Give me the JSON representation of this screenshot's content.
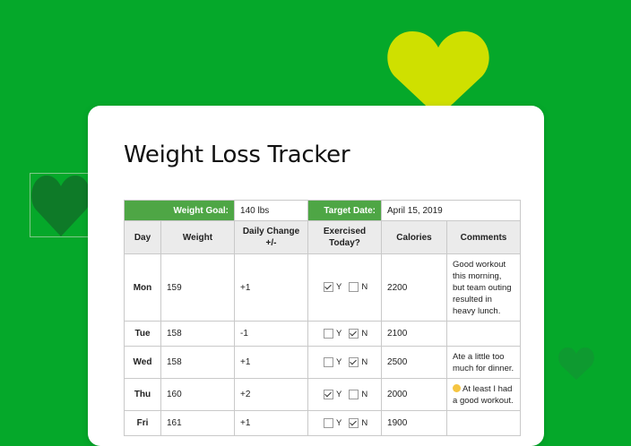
{
  "title": "Weight Loss Tracker",
  "colors": {
    "background": "#05a82a",
    "header_green": "#4ea645",
    "heart_yellow": "#cfe000",
    "heart_dark": "#0e7a28"
  },
  "goal": {
    "weight_label": "Weight Goal:",
    "weight_value": "140 lbs",
    "date_label": "Target Date:",
    "date_value": "April 15, 2019"
  },
  "columns": [
    "Day",
    "Weight",
    "Daily Change +/-",
    "Exercised Today?",
    "Calories",
    "Comments"
  ],
  "yes_label": "Y",
  "no_label": "N",
  "rows": [
    {
      "day": "Mon",
      "weight": "159",
      "change": "+1",
      "exercised": true,
      "calories": "2200",
      "comment": "Good workout this morning, but team outing resulted in heavy lunch."
    },
    {
      "day": "Tue",
      "weight": "158",
      "change": "-1",
      "exercised": false,
      "calories": "2100",
      "comment": ""
    },
    {
      "day": "Wed",
      "weight": "158",
      "change": "+1",
      "exercised": false,
      "calories": "2500",
      "comment": "Ate a little too much for dinner."
    },
    {
      "day": "Thu",
      "weight": "160",
      "change": "+2",
      "exercised": true,
      "calories": "2000",
      "comment": "At least I had a good workout."
    },
    {
      "day": "Fri",
      "weight": "161",
      "change": "+1",
      "exercised": false,
      "calories": "1900",
      "comment": ""
    }
  ],
  "icons": [
    "heart-icon",
    "checkbox-icon",
    "grin-emoji-icon"
  ]
}
